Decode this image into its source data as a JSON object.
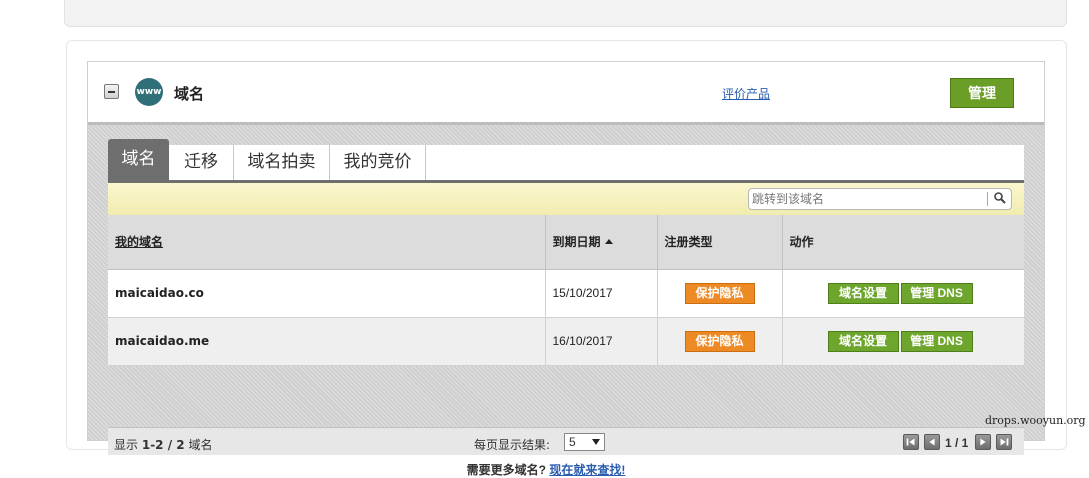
{
  "panel": {
    "title": "域名",
    "icon_text": "www",
    "rate_link": "评价产品",
    "manage_label": "管理"
  },
  "tabs": [
    {
      "label": "域名",
      "active": true
    },
    {
      "label": "迁移",
      "active": false
    },
    {
      "label": "域名拍卖",
      "active": false
    },
    {
      "label": "我的竞价",
      "active": false
    }
  ],
  "search": {
    "placeholder": "跳转到该域名"
  },
  "table": {
    "headers": [
      "我的域名",
      "到期日期",
      "注册类型",
      "动作"
    ],
    "rows": [
      {
        "domain": "maicaidao.co",
        "expiry": "15/10/2017",
        "privacy_label": "保护隐私",
        "settings_label": "域名设置",
        "dns_label": "管理 DNS"
      },
      {
        "domain": "maicaidao.me",
        "expiry": "16/10/2017",
        "privacy_label": "保护隐私",
        "settings_label": "域名设置",
        "dns_label": "管理 DNS"
      }
    ]
  },
  "footer": {
    "count_prefix": "显示",
    "count_range": "1-2 / 2",
    "count_suffix": "域名",
    "perpage_label": "每页显示结果:",
    "perpage_value": "5",
    "page_text": "1 / 1"
  },
  "more": {
    "text": "需要更多域名?",
    "link": "现在就来查找!"
  },
  "watermark": "drops.wooyun.org",
  "colors": {
    "manage_green": "#6a9e27",
    "privacy_orange": "#ee8a23",
    "action_green": "#6da52d",
    "link_blue": "#2a5db0"
  }
}
